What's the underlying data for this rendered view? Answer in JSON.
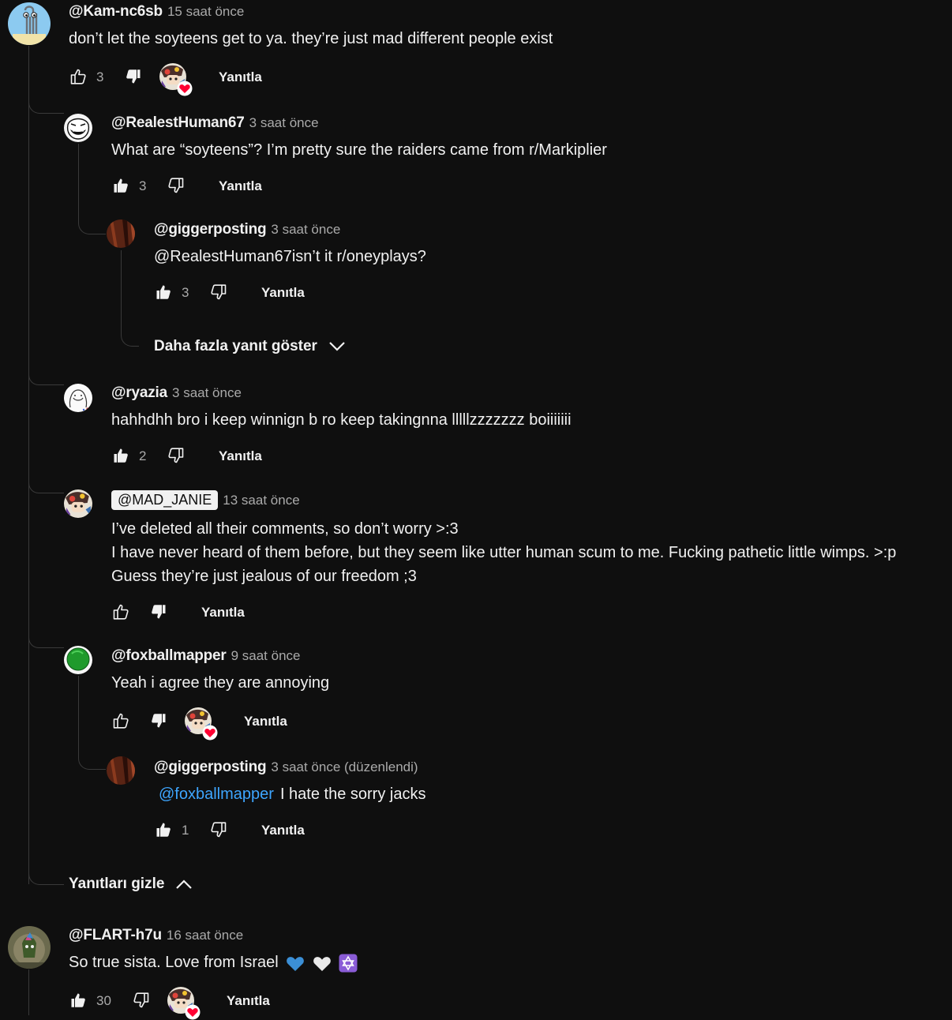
{
  "colors": {
    "background": "#0f0f0f",
    "text": "#f1f1f1",
    "muted": "#aaaaaa",
    "link": "#3ea6ff",
    "heart": "#ff0033"
  },
  "comments": [
    {
      "author": "@Kam-nc6sb",
      "time": "15 saat önce",
      "text": "don’t let the soyteens get to ya. they’re just mad different people exist",
      "likes": "3",
      "reply": "Yanıtla"
    },
    {
      "author": "@RealestHuman67",
      "time": "3 saat önce",
      "text": "What are “soyteens”? I’m pretty sure the raiders came from r/Markiplier",
      "likes": "3",
      "reply": "Yanıtla"
    },
    {
      "author": "@giggerposting",
      "time": "3 saat önce",
      "text": "@RealestHuman67isn’t it r/oneyplays?",
      "likes": "3",
      "reply": "Yanıtla"
    },
    {
      "author": "@ryazia",
      "time": "3 saat önce",
      "text": "hahhdhh bro i keep winnign b ro keep takingnna lllllzzzzzzz boiiiiiii",
      "likes": "2",
      "reply": "Yanıtla"
    },
    {
      "author": "@MAD_JANIE",
      "time": "13 saat önce",
      "lines": [
        "I’ve deleted all their comments, so don’t worry >:3",
        "I have never heard of them before, but they seem like utter human scum to me. Fucking pathetic little wimps. >:p",
        "Guess they’re just jealous of our freedom ;3"
      ],
      "reply": "Yanıtla"
    },
    {
      "author": "@foxballmapper",
      "time": "9 saat önce",
      "text": "Yeah i agree they are annoying",
      "reply": "Yanıtla"
    },
    {
      "author": "@giggerposting",
      "time": "3 saat önce (düzenlendi)",
      "mention": "@foxballmapper",
      "text": "I hate the sorry jacks",
      "likes": "1",
      "reply": "Yanıtla"
    },
    {
      "author": "@FLART-h7u",
      "time": "16 saat önce",
      "text": "So true sista. Love from Israel",
      "likes": "30",
      "reply": "Yanıtla"
    }
  ],
  "more_replies": "Daha fazla yanıt göster",
  "hide_replies": "Yanıtları gizle"
}
